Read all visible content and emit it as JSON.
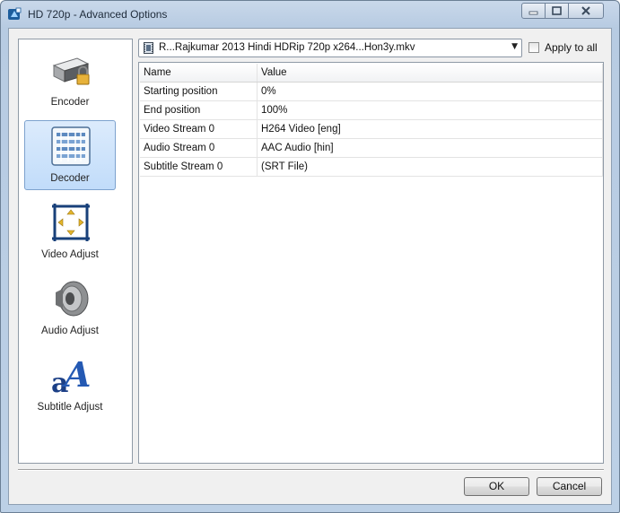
{
  "window": {
    "title": "HD 720p - Advanced Options"
  },
  "sidebar": {
    "items": [
      {
        "label": "Encoder",
        "icon": "encoder-lock-icon",
        "selected": false
      },
      {
        "label": "Decoder",
        "icon": "decoder-chip-icon",
        "selected": true
      },
      {
        "label": "Video Adjust",
        "icon": "video-adjust-icon",
        "selected": false
      },
      {
        "label": "Audio Adjust",
        "icon": "speaker-icon",
        "selected": false
      },
      {
        "label": "Subtitle Adjust",
        "icon": "subtitle-font-icon",
        "selected": false
      }
    ]
  },
  "file_select": {
    "value": "R...Rajkumar 2013 Hindi HDRip 720p x264...Hon3y.mkv",
    "icon": "film-file-icon"
  },
  "apply_to_all": {
    "label": "Apply to all",
    "checked": false
  },
  "grid": {
    "columns": [
      "Name",
      "Value"
    ],
    "rows": [
      {
        "name": "Starting position",
        "value": "0%"
      },
      {
        "name": "End position",
        "value": "100%"
      },
      {
        "name": "Video Stream 0",
        "value": "H264 Video [eng]"
      },
      {
        "name": "Audio Stream 0",
        "value": "AAC Audio [hin]"
      },
      {
        "name": "Subtitle Stream 0",
        "value": "(SRT File)"
      }
    ]
  },
  "buttons": {
    "ok": "OK",
    "cancel": "Cancel"
  },
  "colors": {
    "selection": "#c1dcfa",
    "frame": "#b7cbe2"
  }
}
